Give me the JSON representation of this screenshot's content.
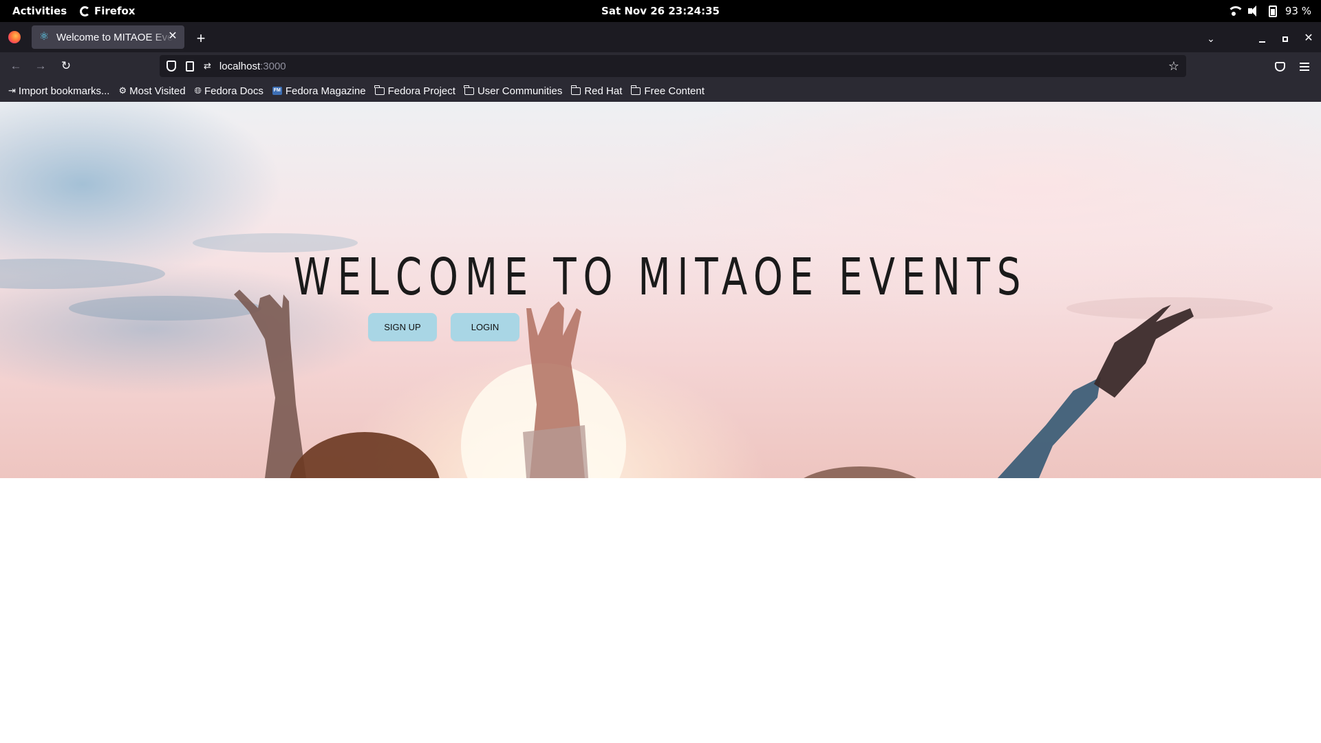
{
  "os": {
    "activities": "Activities",
    "app_name": "Firefox",
    "clock": "Sat Nov 26  23:24:35",
    "battery": "93 %"
  },
  "browser": {
    "tab_title": "Welcome to MITAOE Events",
    "url_host": "localhost",
    "url_port": ":3000",
    "bookmarks": [
      {
        "label": "Import bookmarks...",
        "icon": "import-icon"
      },
      {
        "label": "Most Visited",
        "icon": "gear-icon"
      },
      {
        "label": "Fedora Docs",
        "icon": "globe-icon"
      },
      {
        "label": "Fedora Magazine",
        "icon": "fedora-magazine-icon"
      },
      {
        "label": "Fedora Project",
        "icon": "folder-icon"
      },
      {
        "label": "User Communities",
        "icon": "folder-icon"
      },
      {
        "label": "Red Hat",
        "icon": "folder-icon"
      },
      {
        "label": "Free Content",
        "icon": "folder-icon"
      }
    ]
  },
  "page": {
    "hero_title": "WELCOME TO MITAOE EVENTS",
    "signup_label": "SIGN UP",
    "login_label": "LOGIN",
    "button_color": "#a9d6e5"
  }
}
